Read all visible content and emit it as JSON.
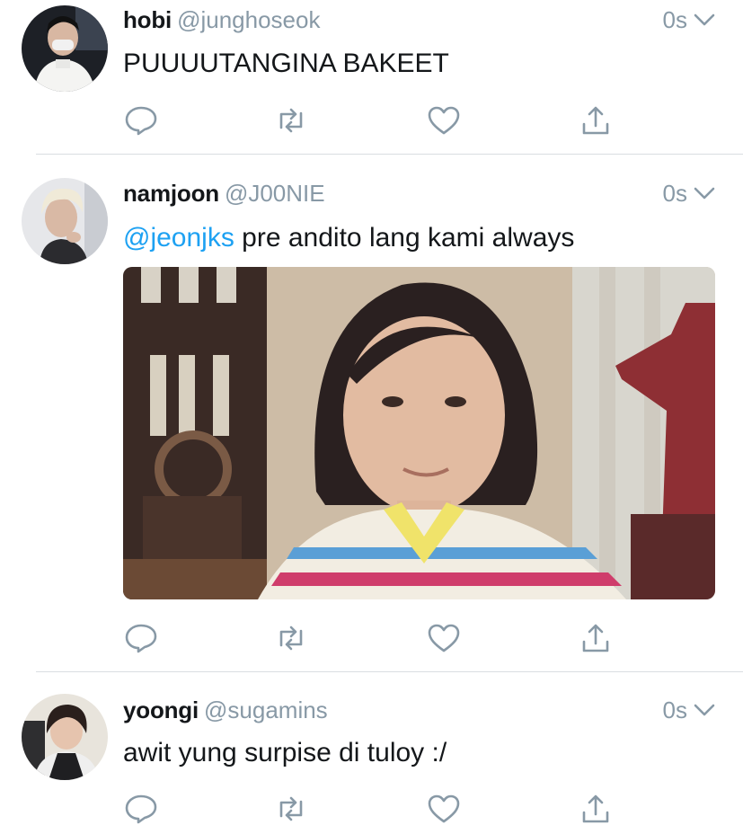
{
  "tweets": [
    {
      "display_name": "hobi",
      "handle": "@junghoseok",
      "time": "0s",
      "text": "PUUUUTANGINA BAKEET",
      "avatar": "avatar-photo"
    },
    {
      "display_name": "namjoon",
      "handle": "@J00NIE",
      "time": "0s",
      "mention": "@jeonjks",
      "text": " pre andito lang kami always",
      "avatar": "avatar-photo",
      "media": "photo-girl-striped-shirt"
    },
    {
      "display_name": "yoongi",
      "handle": "@sugamins",
      "time": "0s",
      "text": "awit yung surpise di tuloy :/",
      "avatar": "avatar-photo"
    }
  ],
  "icons": {
    "reply": "reply-icon",
    "retweet": "retweet-icon",
    "like": "heart-icon",
    "share": "share-icon",
    "menu": "chevron-down-icon"
  },
  "colors": {
    "text": "#14171a",
    "secondary": "#8899a6",
    "link": "#1da1f2",
    "divider": "#d9dde1"
  }
}
